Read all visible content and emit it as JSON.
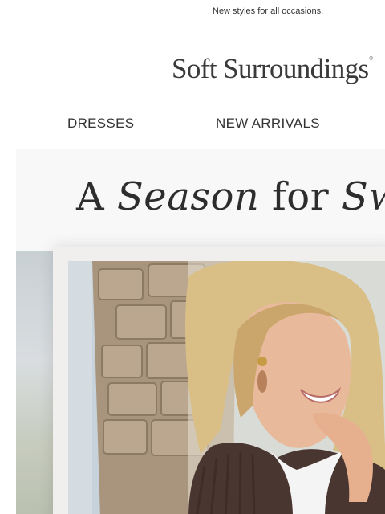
{
  "preheader": {
    "text": "New styles for all occasions."
  },
  "header": {
    "logo_text": "Soft Surroundings",
    "logo_mark": "®"
  },
  "nav": {
    "items": [
      {
        "label": "DRESSES"
      },
      {
        "label": "NEW ARRIVALS"
      }
    ]
  },
  "hero": {
    "headline_1": "A ",
    "headline_2": "Season",
    "headline_3": " for ",
    "headline_4": "Swea",
    "image": "hero-photo-woman-in-brown-sweater"
  },
  "colors": {
    "text": "#333333",
    "divider": "#bfbfbf",
    "hero_bg": "#f8f8f8",
    "sweater": "#4a3630"
  }
}
